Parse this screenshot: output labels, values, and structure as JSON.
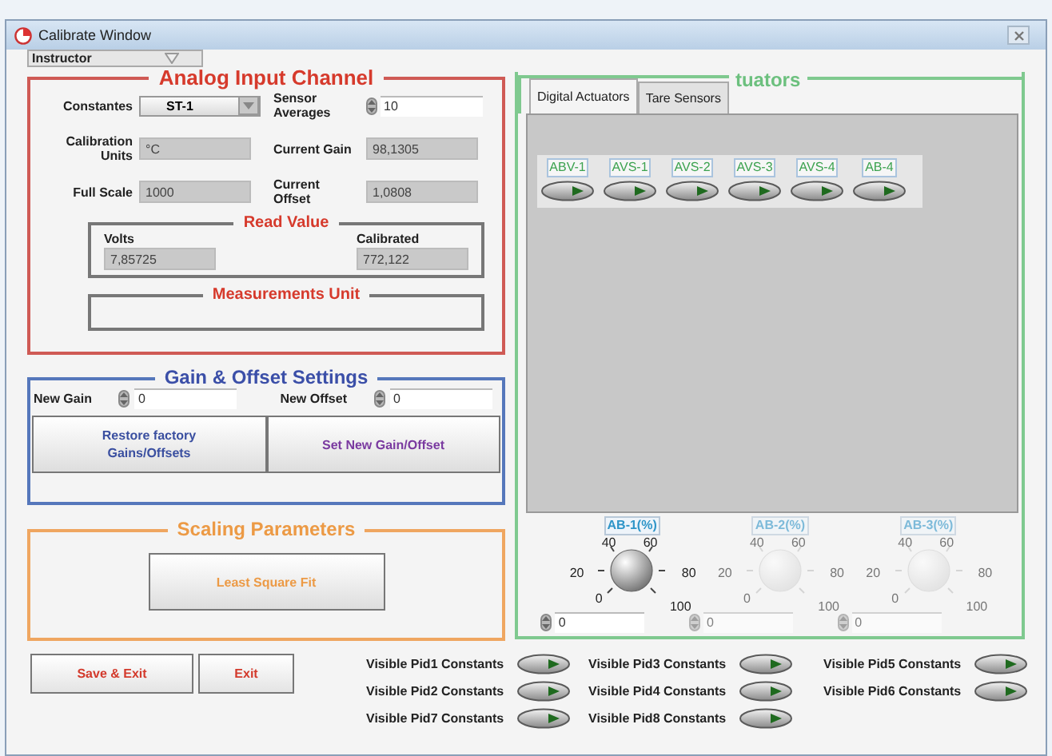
{
  "window": {
    "title": "Calibrate Window"
  },
  "user_select": {
    "value": "Instructor"
  },
  "analog_input": {
    "title": "Analog Input Channel",
    "fields": [
      {
        "label": "Constantes",
        "kind": "select",
        "value": "ST-1"
      },
      {
        "label": "Sensor Averages",
        "kind": "spin",
        "value": "10"
      },
      {
        "label": "Calibration Units",
        "kind": "display",
        "value": "°C"
      },
      {
        "label": "Current Gain",
        "kind": "display",
        "value": "98,1305"
      },
      {
        "label": "Full Scale",
        "kind": "display",
        "value": "1000"
      },
      {
        "label": "Current Offset",
        "kind": "display",
        "value": "1,0808"
      }
    ],
    "read_value": {
      "title": "Read Value",
      "items": [
        {
          "label": "Volts",
          "value": "7,85725"
        },
        {
          "label": "Calibrated",
          "value": "772,122"
        }
      ]
    },
    "measurements_unit": {
      "title": "Measurements Unit"
    }
  },
  "gain_offset": {
    "title": "Gain & Offset Settings",
    "fields": [
      {
        "label": "New Gain",
        "value": "0"
      },
      {
        "label": "New Offset",
        "value": "0"
      }
    ],
    "buttons": [
      {
        "label": "Restore factory Gains/Offsets",
        "color": "#3a4fa0"
      },
      {
        "label": "Set New Gain/Offset",
        "color": "#7a3aa0"
      }
    ]
  },
  "scaling": {
    "title": "Scaling Parameters",
    "button": "Least Square Fit"
  },
  "actions": [
    "Save & Exit",
    "Exit"
  ],
  "actuators": {
    "title": "tuators",
    "tabs": [
      {
        "label": "Digital Actuators",
        "selected": true
      },
      {
        "label": "Tare Sensors",
        "selected": false
      }
    ],
    "switches": [
      {
        "label": "ABV-1",
        "on": false
      },
      {
        "label": "AVS-1",
        "on": false
      },
      {
        "label": "AVS-2",
        "on": false
      },
      {
        "label": "AVS-3",
        "on": false
      },
      {
        "label": "AVS-4",
        "on": false
      },
      {
        "label": "AB-4",
        "on": false
      }
    ],
    "knobs": [
      {
        "label": "AB-1(%)",
        "disabled": false,
        "value": "0",
        "scale": [
          "0",
          "20",
          "40",
          "60",
          "80",
          "100"
        ]
      },
      {
        "label": "AB-2(%)",
        "disabled": true,
        "value": "0",
        "scale": [
          "0",
          "20",
          "40",
          "60",
          "80",
          "100"
        ]
      },
      {
        "label": "AB-3(%)",
        "disabled": true,
        "value": "0",
        "scale": [
          "0",
          "20",
          "40",
          "60",
          "80",
          "100"
        ]
      }
    ]
  },
  "pid_toggles": [
    {
      "label": "Visible Pid1 Constants",
      "on": false
    },
    {
      "label": "Visible Pid3 Constants",
      "on": false
    },
    {
      "label": "Visible Pid5 Constants",
      "on": false
    },
    {
      "label": "Visible Pid2 Constants",
      "on": false
    },
    {
      "label": "Visible Pid4 Constants",
      "on": false
    },
    {
      "label": "Visible Pid6 Constants",
      "on": false
    },
    {
      "label": "Visible Pid7 Constants",
      "on": false
    },
    {
      "label": "Visible Pid8 Constants",
      "on": false
    }
  ]
}
